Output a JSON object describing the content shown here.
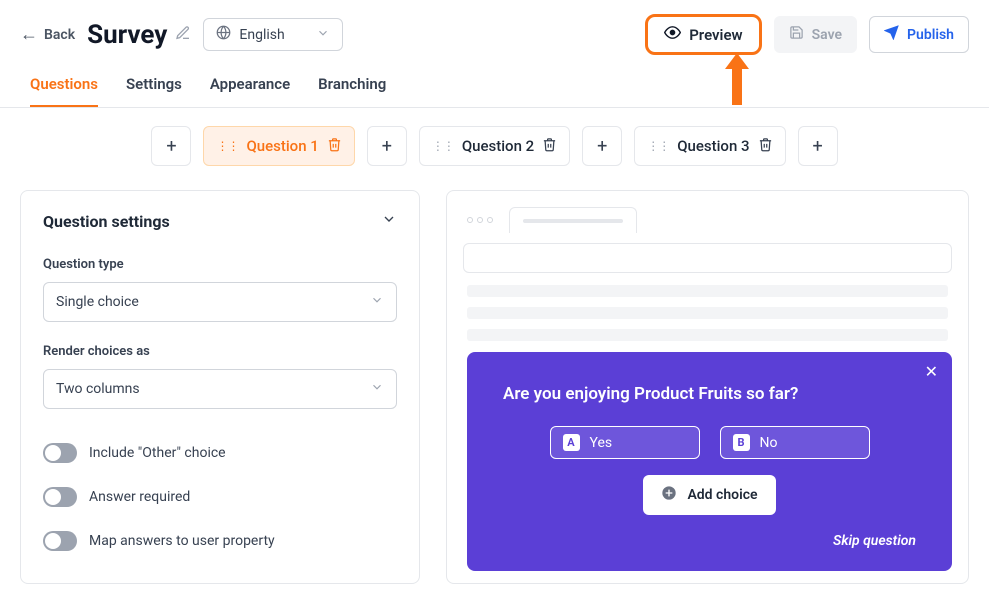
{
  "header": {
    "back": "Back",
    "title": "Survey",
    "language": "English",
    "preview": "Preview",
    "save": "Save",
    "publish": "Publish"
  },
  "tabs": [
    "Questions",
    "Settings",
    "Appearance",
    "Branching"
  ],
  "questions": {
    "items": [
      "Question 1",
      "Question 2",
      "Question 3"
    ],
    "active_index": 0
  },
  "settings": {
    "panel_title": "Question settings",
    "type_label": "Question type",
    "type_value": "Single choice",
    "render_label": "Render choices as",
    "render_value": "Two columns",
    "toggle_other": "Include \"Other\" choice",
    "toggle_required": "Answer required",
    "toggle_map": "Map answers to user property"
  },
  "preview": {
    "question": "Are you enjoying Product Fruits so far?",
    "choice_a_key": "A",
    "choice_a": "Yes",
    "choice_b_key": "B",
    "choice_b": "No",
    "add_choice": "Add choice",
    "skip": "Skip question"
  },
  "colors": {
    "accent": "#f97316",
    "primary": "#5b3fd6",
    "publish": "#2563eb"
  }
}
